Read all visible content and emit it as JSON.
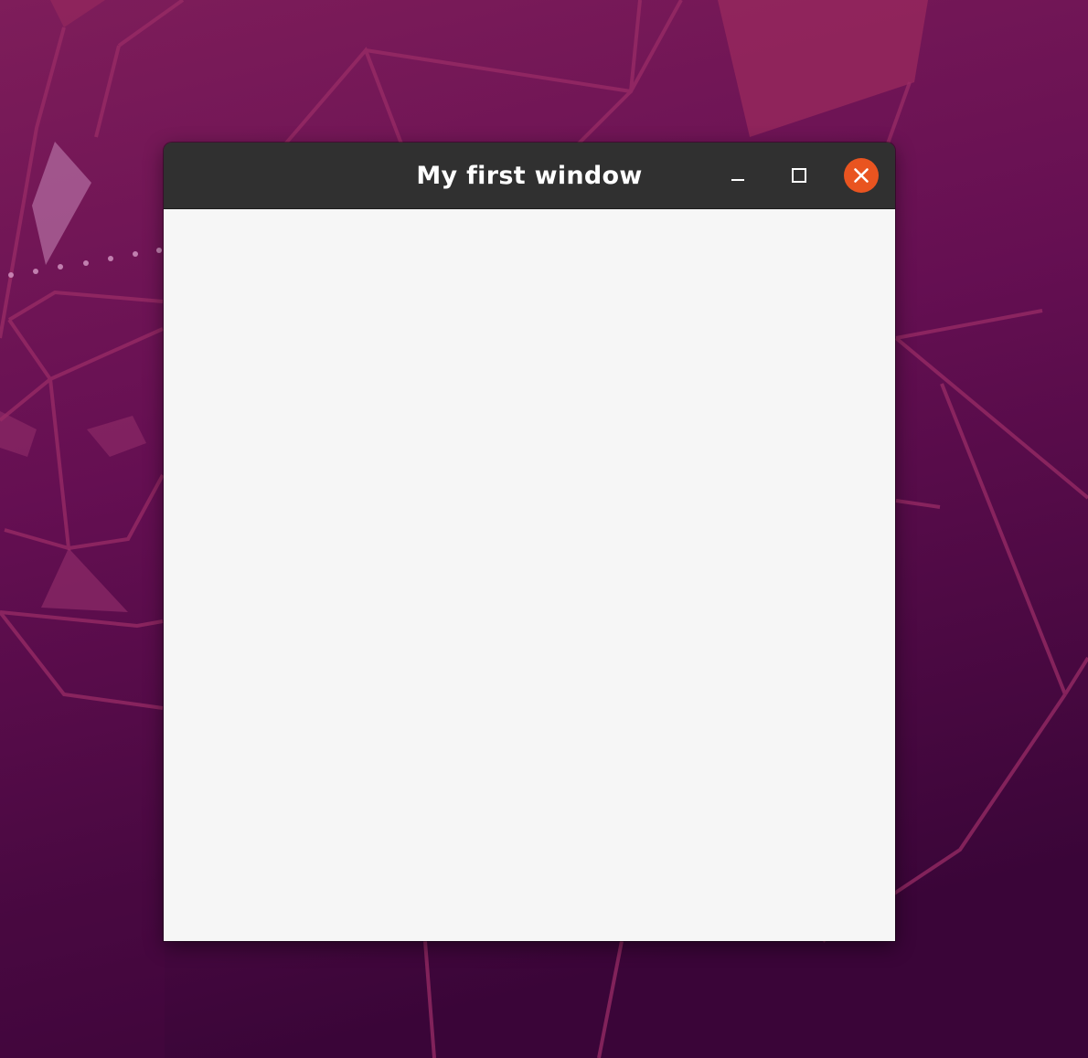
{
  "window": {
    "title": "My first window",
    "controls": {
      "minimize_icon": "minimize-icon",
      "maximize_icon": "maximize-icon",
      "close_icon": "close-icon"
    },
    "content": ""
  },
  "theme": {
    "titlebar_bg": "#303030",
    "title_color": "#ffffff",
    "close_accent": "#e95420",
    "content_bg": "#f6f6f6",
    "desktop_top": "#7a1f59",
    "desktop_bottom": "#3a0636"
  }
}
